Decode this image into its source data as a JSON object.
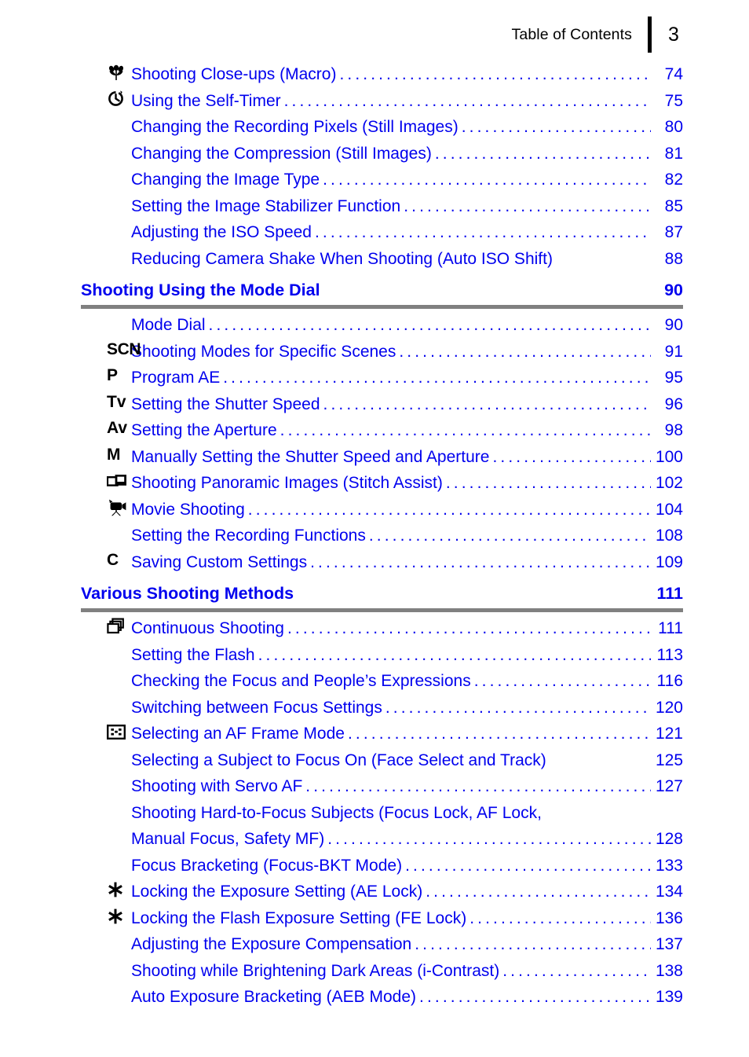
{
  "header": {
    "title": "Table of Contents",
    "page_number": "3",
    "text_color": "#000000"
  },
  "colors": {
    "link_blue": "#0000ee",
    "icon_black": "#000000",
    "rule_gray": "#808080"
  },
  "toc": {
    "leading_entries": [
      {
        "icon": "macro-flower-icon",
        "label": "Shooting Close-ups (Macro)",
        "page": "74"
      },
      {
        "icon": "self-timer-icon",
        "label": "Using the Self-Timer",
        "page": "75"
      },
      {
        "icon": null,
        "label": "Changing the Recording Pixels (Still Images)",
        "page": "80"
      },
      {
        "icon": null,
        "label": "Changing the Compression (Still Images)",
        "page": "81"
      },
      {
        "icon": null,
        "label": "Changing the Image Type",
        "page": "82"
      },
      {
        "icon": null,
        "label": "Setting the Image Stabilizer Function",
        "page": "85"
      },
      {
        "icon": null,
        "label": "Adjusting the ISO Speed",
        "page": "87"
      },
      {
        "icon": null,
        "label": "Reducing Camera Shake When Shooting (Auto ISO Shift)",
        "page": "88",
        "no_leader": true
      }
    ],
    "sections": [
      {
        "title": "Shooting Using the Mode Dial",
        "page": "90",
        "entries": [
          {
            "icon": null,
            "label": "Mode Dial",
            "page": "90"
          },
          {
            "icon": "scn-mode-icon",
            "icon_text": "SCN",
            "label": "Shooting Modes for Specific Scenes",
            "page": "91"
          },
          {
            "icon": "program-ae-mode-icon",
            "icon_text": "P",
            "label": "Program AE",
            "page": "95"
          },
          {
            "icon": "tv-mode-icon",
            "icon_text": "Tv",
            "label": "Setting the Shutter Speed",
            "page": "96"
          },
          {
            "icon": "av-mode-icon",
            "icon_text": "Av",
            "label": "Setting the Aperture",
            "page": "98"
          },
          {
            "icon": "manual-mode-icon",
            "icon_text": "M",
            "label": "Manually Setting the Shutter Speed and Aperture",
            "page": "100"
          },
          {
            "icon": "stitch-assist-icon",
            "label": "Shooting Panoramic Images (Stitch Assist)",
            "page": "102"
          },
          {
            "icon": "movie-camera-icon",
            "label": "Movie Shooting",
            "page": "104"
          },
          {
            "icon": null,
            "label": "Setting the Recording Functions",
            "page": "108"
          },
          {
            "icon": "custom-settings-icon",
            "icon_text": "C",
            "label": "Saving Custom Settings",
            "page": "109"
          }
        ]
      },
      {
        "title": "Various Shooting Methods",
        "page": "111",
        "entries": [
          {
            "icon": "continuous-shooting-icon",
            "label": "Continuous Shooting",
            "page": "111"
          },
          {
            "icon": null,
            "label": "Setting the Flash",
            "page": "113"
          },
          {
            "icon": null,
            "label": "Checking the Focus and People’s Expressions",
            "page": "116"
          },
          {
            "icon": null,
            "label": "Switching between Focus Settings",
            "page": "120"
          },
          {
            "icon": "af-frame-icon",
            "label": "Selecting an AF Frame Mode",
            "page": "121"
          },
          {
            "icon": null,
            "label": "Selecting a Subject to Focus On (Face Select and Track)",
            "page": "125",
            "no_leader": true
          },
          {
            "icon": null,
            "label": "Shooting with Servo AF",
            "page": "127"
          },
          {
            "icon": null,
            "label": "Shooting Hard-to-Focus Subjects (Focus Lock, AF Lock,",
            "page": "",
            "first_line": true
          },
          {
            "icon": null,
            "label": "Manual Focus, Safety MF)",
            "page": "128",
            "continuation": true
          },
          {
            "icon": null,
            "label": "Focus Bracketing (Focus-BKT Mode)",
            "page": "133"
          },
          {
            "icon": "ae-lock-asterisk-icon",
            "label": "Locking the Exposure Setting (AE Lock)",
            "page": "134"
          },
          {
            "icon": "fe-lock-asterisk-icon",
            "label": "Locking the Flash Exposure Setting (FE Lock)",
            "page": "136"
          },
          {
            "icon": null,
            "label": "Adjusting the Exposure Compensation",
            "page": "137"
          },
          {
            "icon": null,
            "label": "Shooting while Brightening Dark Areas (i-Contrast)",
            "page": "138"
          },
          {
            "icon": null,
            "label": "Auto Exposure Bracketing (AEB Mode)",
            "page": "139"
          }
        ]
      }
    ]
  }
}
